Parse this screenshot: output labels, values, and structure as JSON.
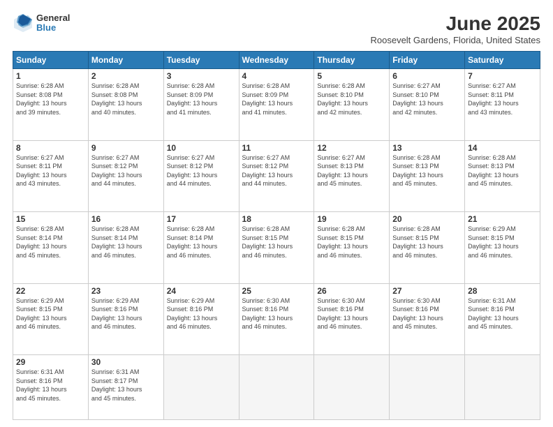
{
  "logo": {
    "general": "General",
    "blue": "Blue"
  },
  "header": {
    "title": "June 2025",
    "location": "Roosevelt Gardens, Florida, United States"
  },
  "weekdays": [
    "Sunday",
    "Monday",
    "Tuesday",
    "Wednesday",
    "Thursday",
    "Friday",
    "Saturday"
  ],
  "days": [
    {
      "num": "",
      "info": ""
    },
    {
      "num": "1",
      "info": "Sunrise: 6:28 AM\nSunset: 8:08 PM\nDaylight: 13 hours\nand 39 minutes."
    },
    {
      "num": "2",
      "info": "Sunrise: 6:28 AM\nSunset: 8:08 PM\nDaylight: 13 hours\nand 40 minutes."
    },
    {
      "num": "3",
      "info": "Sunrise: 6:28 AM\nSunset: 8:09 PM\nDaylight: 13 hours\nand 41 minutes."
    },
    {
      "num": "4",
      "info": "Sunrise: 6:28 AM\nSunset: 8:09 PM\nDaylight: 13 hours\nand 41 minutes."
    },
    {
      "num": "5",
      "info": "Sunrise: 6:28 AM\nSunset: 8:10 PM\nDaylight: 13 hours\nand 42 minutes."
    },
    {
      "num": "6",
      "info": "Sunrise: 6:27 AM\nSunset: 8:10 PM\nDaylight: 13 hours\nand 42 minutes."
    },
    {
      "num": "7",
      "info": "Sunrise: 6:27 AM\nSunset: 8:11 PM\nDaylight: 13 hours\nand 43 minutes."
    },
    {
      "num": "8",
      "info": "Sunrise: 6:27 AM\nSunset: 8:11 PM\nDaylight: 13 hours\nand 43 minutes."
    },
    {
      "num": "9",
      "info": "Sunrise: 6:27 AM\nSunset: 8:12 PM\nDaylight: 13 hours\nand 44 minutes."
    },
    {
      "num": "10",
      "info": "Sunrise: 6:27 AM\nSunset: 8:12 PM\nDaylight: 13 hours\nand 44 minutes."
    },
    {
      "num": "11",
      "info": "Sunrise: 6:27 AM\nSunset: 8:12 PM\nDaylight: 13 hours\nand 44 minutes."
    },
    {
      "num": "12",
      "info": "Sunrise: 6:27 AM\nSunset: 8:13 PM\nDaylight: 13 hours\nand 45 minutes."
    },
    {
      "num": "13",
      "info": "Sunrise: 6:28 AM\nSunset: 8:13 PM\nDaylight: 13 hours\nand 45 minutes."
    },
    {
      "num": "14",
      "info": "Sunrise: 6:28 AM\nSunset: 8:13 PM\nDaylight: 13 hours\nand 45 minutes."
    },
    {
      "num": "15",
      "info": "Sunrise: 6:28 AM\nSunset: 8:14 PM\nDaylight: 13 hours\nand 45 minutes."
    },
    {
      "num": "16",
      "info": "Sunrise: 6:28 AM\nSunset: 8:14 PM\nDaylight: 13 hours\nand 46 minutes."
    },
    {
      "num": "17",
      "info": "Sunrise: 6:28 AM\nSunset: 8:14 PM\nDaylight: 13 hours\nand 46 minutes."
    },
    {
      "num": "18",
      "info": "Sunrise: 6:28 AM\nSunset: 8:15 PM\nDaylight: 13 hours\nand 46 minutes."
    },
    {
      "num": "19",
      "info": "Sunrise: 6:28 AM\nSunset: 8:15 PM\nDaylight: 13 hours\nand 46 minutes."
    },
    {
      "num": "20",
      "info": "Sunrise: 6:28 AM\nSunset: 8:15 PM\nDaylight: 13 hours\nand 46 minutes."
    },
    {
      "num": "21",
      "info": "Sunrise: 6:29 AM\nSunset: 8:15 PM\nDaylight: 13 hours\nand 46 minutes."
    },
    {
      "num": "22",
      "info": "Sunrise: 6:29 AM\nSunset: 8:15 PM\nDaylight: 13 hours\nand 46 minutes."
    },
    {
      "num": "23",
      "info": "Sunrise: 6:29 AM\nSunset: 8:16 PM\nDaylight: 13 hours\nand 46 minutes."
    },
    {
      "num": "24",
      "info": "Sunrise: 6:29 AM\nSunset: 8:16 PM\nDaylight: 13 hours\nand 46 minutes."
    },
    {
      "num": "25",
      "info": "Sunrise: 6:30 AM\nSunset: 8:16 PM\nDaylight: 13 hours\nand 46 minutes."
    },
    {
      "num": "26",
      "info": "Sunrise: 6:30 AM\nSunset: 8:16 PM\nDaylight: 13 hours\nand 46 minutes."
    },
    {
      "num": "27",
      "info": "Sunrise: 6:30 AM\nSunset: 8:16 PM\nDaylight: 13 hours\nand 45 minutes."
    },
    {
      "num": "28",
      "info": "Sunrise: 6:31 AM\nSunset: 8:16 PM\nDaylight: 13 hours\nand 45 minutes."
    },
    {
      "num": "29",
      "info": "Sunrise: 6:31 AM\nSunset: 8:16 PM\nDaylight: 13 hours\nand 45 minutes."
    },
    {
      "num": "30",
      "info": "Sunrise: 6:31 AM\nSunset: 8:17 PM\nDaylight: 13 hours\nand 45 minutes."
    },
    {
      "num": "",
      "info": ""
    },
    {
      "num": "",
      "info": ""
    },
    {
      "num": "",
      "info": ""
    },
    {
      "num": "",
      "info": ""
    },
    {
      "num": "",
      "info": ""
    }
  ]
}
